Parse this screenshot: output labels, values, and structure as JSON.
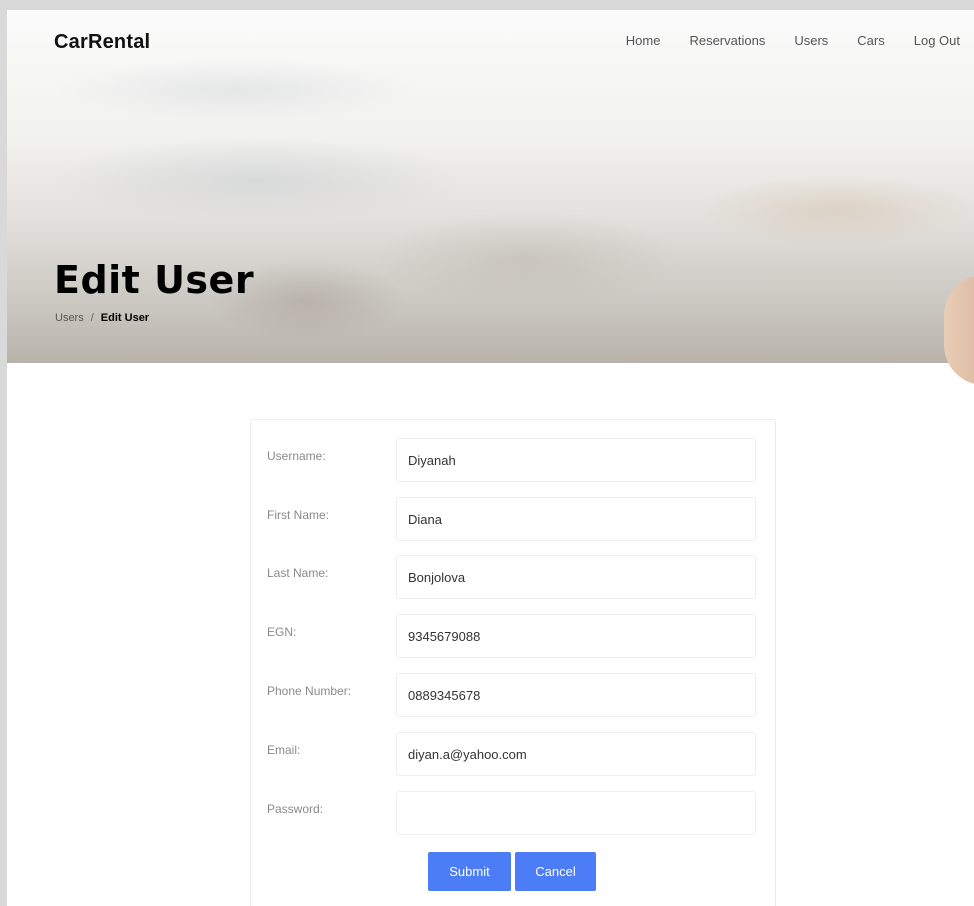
{
  "nav": {
    "brand": "CarRental",
    "items": [
      {
        "label": "Home"
      },
      {
        "label": "Reservations"
      },
      {
        "label": "Users"
      },
      {
        "label": "Cars"
      },
      {
        "label": "Log Out"
      }
    ]
  },
  "hero": {
    "title": "Edit User",
    "breadcrumb": {
      "parent": "Users",
      "separator": "/",
      "current": "Edit User"
    }
  },
  "form": {
    "fields": [
      {
        "label": "Username:",
        "value": "Diyanah"
      },
      {
        "label": "First Name:",
        "value": "Diana"
      },
      {
        "label": "Last Name:",
        "value": "Bonjolova"
      },
      {
        "label": "EGN:",
        "value": "9345679088"
      },
      {
        "label": "Phone Number:",
        "value": "0889345678"
      },
      {
        "label": "Email:",
        "value": "diyan.a@yahoo.com"
      },
      {
        "label": "Password:",
        "value": ""
      }
    ],
    "submit_label": "Submit",
    "cancel_label": "Cancel"
  },
  "colors": {
    "accent": "#4d7cf7"
  }
}
